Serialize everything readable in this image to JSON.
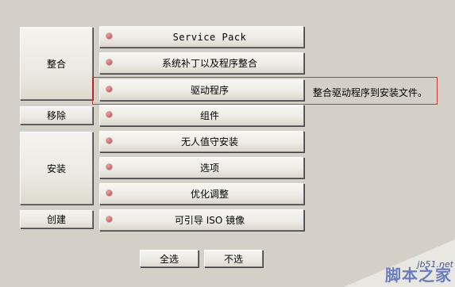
{
  "categories": {
    "integrate": "整合",
    "remove": "移除",
    "setup": "安装",
    "create": "创建"
  },
  "items": {
    "service_pack": "Service Pack",
    "hotfixes": "系统补丁以及程序整合",
    "drivers": "驱动程序",
    "components": "组件",
    "unattended": "无人值守安装",
    "options": "选项",
    "tweaks": "优化调整",
    "bootable_iso": "可引导 ISO 镜像"
  },
  "tooltip": "整合驱动程序到安装文件。",
  "footer": {
    "select_all": "全选",
    "select_none": "不选"
  },
  "watermark": {
    "site": "jb51.net",
    "brand": "脚本之家"
  },
  "colors": {
    "background": "#d4d0c8",
    "highlight_border": "#c43a3a",
    "dot": "#d26a6a"
  }
}
